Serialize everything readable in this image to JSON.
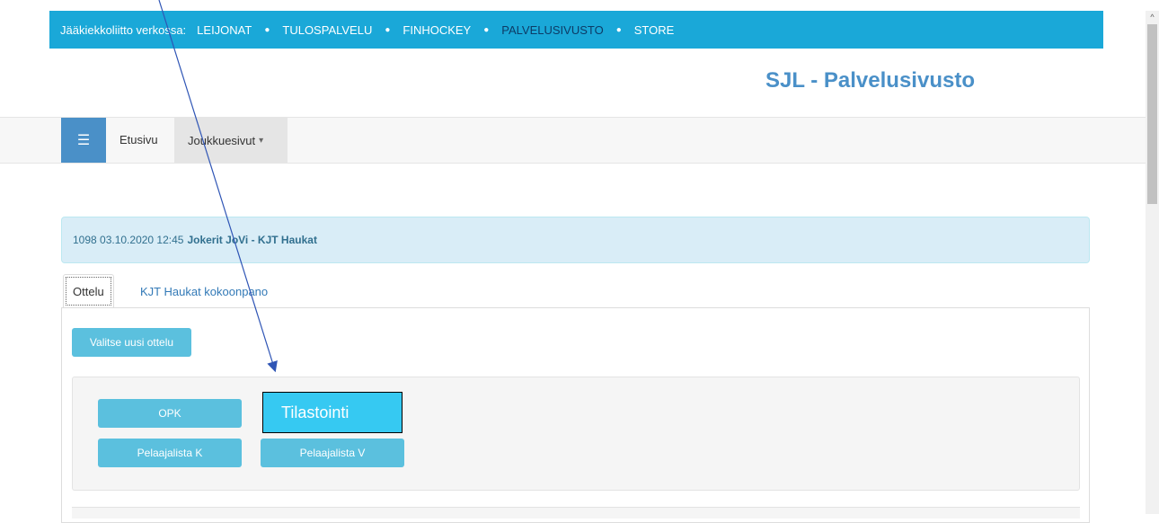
{
  "topbar": {
    "lead": "Jääkiekkoliitto verkossa:",
    "links": [
      {
        "label": "LEIJONAT",
        "active": false
      },
      {
        "label": "TULOSPALVELU",
        "active": false
      },
      {
        "label": "FINHOCKEY",
        "active": false
      },
      {
        "label": "PALVELUSIVUSTO",
        "active": true
      },
      {
        "label": "STORE",
        "active": false
      }
    ]
  },
  "site_title": "SJL - Palvelusivusto",
  "navbar": {
    "menu_icon": "hamburger-icon",
    "home": "Etusivu",
    "teams": "Joukkuesivut"
  },
  "match": {
    "prefix": "1098 03.10.2020 12:45",
    "teams": "Jokerit JoVi - KJT Haukat"
  },
  "tabs": [
    {
      "label": "Ottelu",
      "active": true
    },
    {
      "label": "KJT Haukat kokoonpano",
      "active": false
    }
  ],
  "buttons": {
    "new_match": "Valitse uusi ottelu",
    "opk": "OPK",
    "roster_k": "Pelaajalista K",
    "roster_v": "Pelaajalista V"
  },
  "annotation": {
    "label": "Tilastointi",
    "color": "#36c9f2",
    "arrow_color": "#2f55b5"
  }
}
